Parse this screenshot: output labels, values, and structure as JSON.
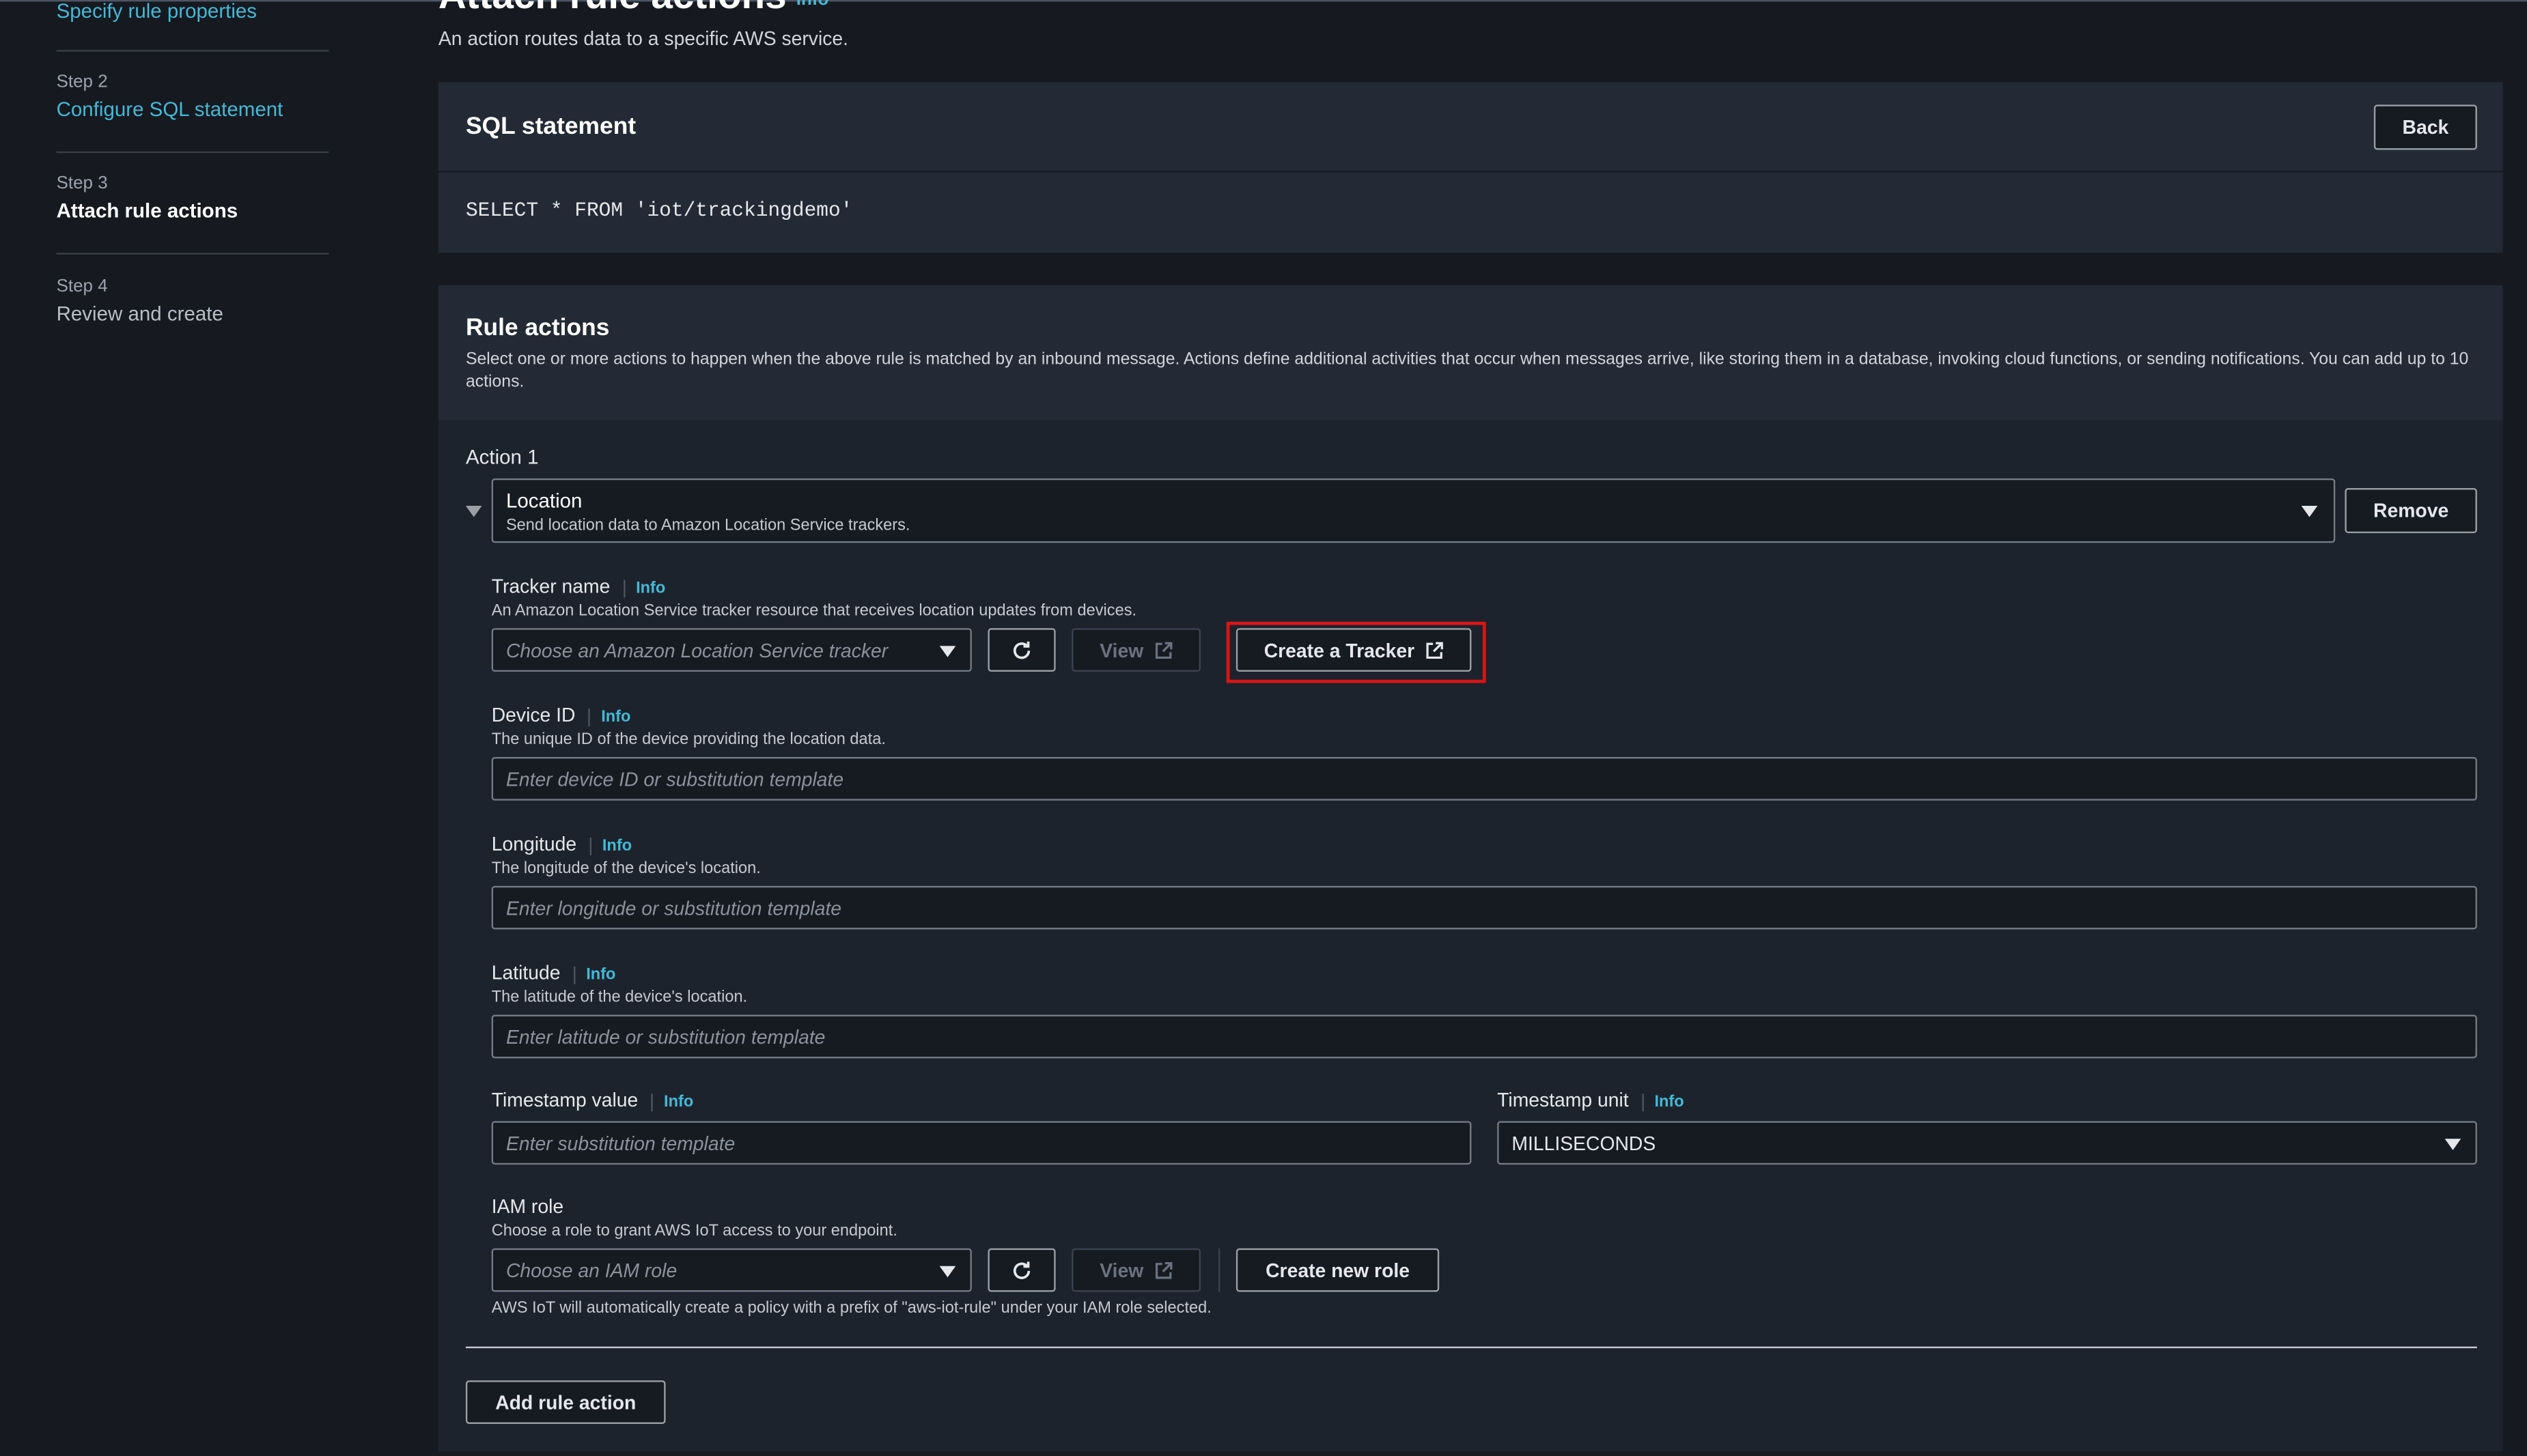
{
  "sidebar": {
    "steps": [
      {
        "label": "",
        "title": "Specify rule properties"
      },
      {
        "label": "Step 2",
        "title": "Configure SQL statement"
      },
      {
        "label": "Step 3",
        "title": "Attach rule actions"
      },
      {
        "label": "Step 4",
        "title": "Review and create"
      }
    ]
  },
  "page": {
    "title": "Attach rule actions",
    "title_info": "Info",
    "description": "An action routes data to a specific AWS service."
  },
  "sql_panel": {
    "title": "SQL statement",
    "back_label": "Back",
    "statement": "SELECT * FROM 'iot/trackingdemo'"
  },
  "rule_actions": {
    "title": "Rule actions",
    "description": "Select one or more actions to happen when the above rule is matched by an inbound message. Actions define additional activities that occur when messages arrive, like storing them in a database, invoking cloud functions, or sending notifications. You can add up to 10 actions.",
    "action_label": "Action 1",
    "action_type": "Location",
    "action_type_desc": "Send location data to Amazon Location Service trackers.",
    "remove_label": "Remove",
    "add_label": "Add rule action"
  },
  "fields": {
    "info": "Info",
    "tracker": {
      "label": "Tracker name",
      "desc": "An Amazon Location Service tracker resource that receives location updates from devices.",
      "placeholder": "Choose an Amazon Location Service tracker",
      "view_label": "View",
      "create_label": "Create a Tracker"
    },
    "device": {
      "label": "Device ID",
      "desc": "The unique ID of the device providing the location data.",
      "placeholder": "Enter device ID or substitution template"
    },
    "longitude": {
      "label": "Longitude",
      "desc": "The longitude of the device's location.",
      "placeholder": "Enter longitude or substitution template"
    },
    "latitude": {
      "label": "Latitude",
      "desc": "The latitude of the device's location.",
      "placeholder": "Enter latitude or substitution template"
    },
    "timestamp_value": {
      "label": "Timestamp value",
      "placeholder": "Enter substitution template"
    },
    "timestamp_unit": {
      "label": "Timestamp unit",
      "value": "MILLISECONDS"
    },
    "iam": {
      "label": "IAM role",
      "desc": "Choose a role to grant AWS IoT access to your endpoint.",
      "placeholder": "Choose an IAM role",
      "view_label": "View",
      "create_label": "Create new role",
      "note": "AWS IoT will automatically create a policy with a prefix of \"aws-iot-rule\" under your IAM role selected."
    }
  },
  "colors": {
    "link": "#44b9d6",
    "highlight": "#d91515",
    "background": "#16191f",
    "panel": "#232a35"
  }
}
